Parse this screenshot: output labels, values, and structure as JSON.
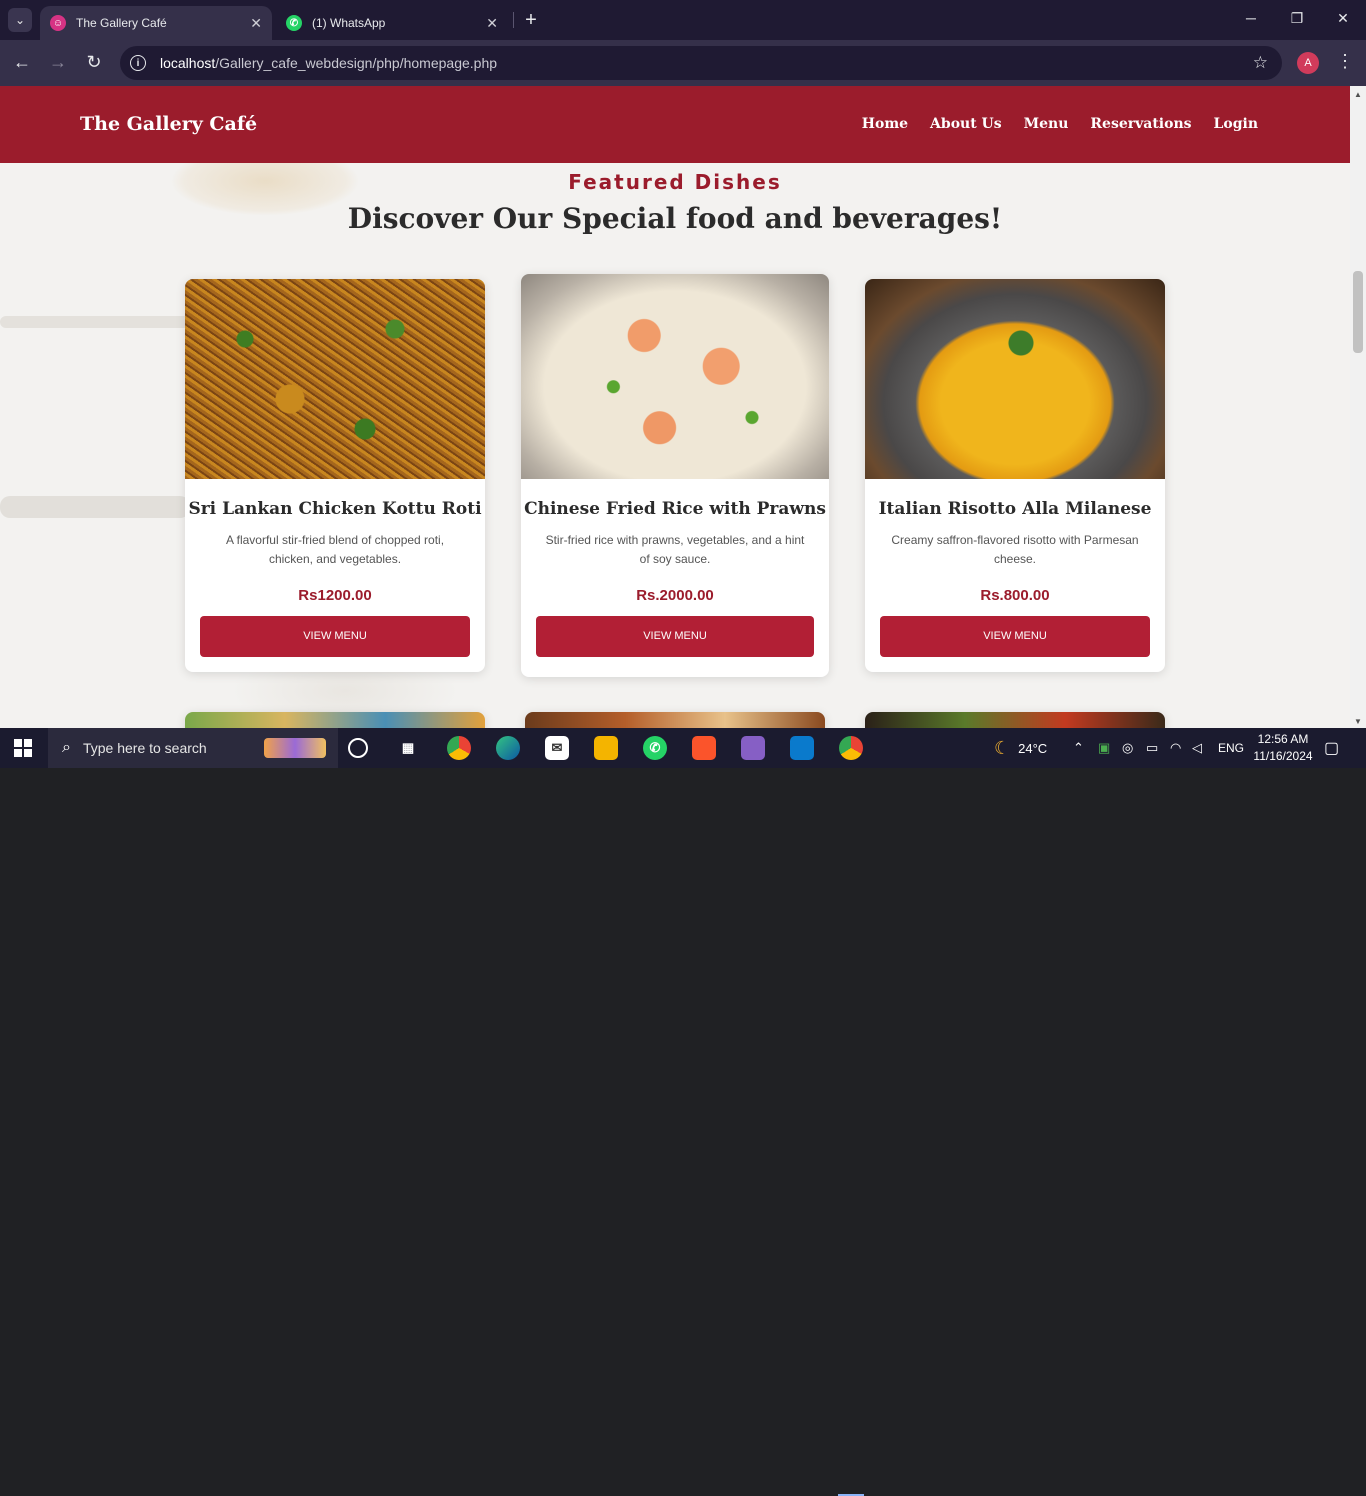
{
  "browser": {
    "tabs": [
      {
        "title": "The Gallery Café",
        "favicon_color": "#d63384",
        "active": true
      },
      {
        "title": "(1) WhatsApp",
        "favicon_color": "#25d366",
        "active": false
      }
    ],
    "url_host": "localhost",
    "url_path": "/Gallery_cafe_webdesign/php/homepage.php",
    "profile_initial": "A"
  },
  "site": {
    "brand": "The Gallery Café",
    "nav": [
      "Home",
      "About Us",
      "Menu",
      "Reservations",
      "Login"
    ],
    "eyebrow": "Featured Dishes",
    "headline": "Discover Our Special food and beverages!",
    "accent_color": "#9b1c2c",
    "button_color": "#b21f35",
    "dishes": [
      {
        "title": "Sri Lankan Chicken Kottu Roti",
        "description": "A flavorful stir-fried blend of chopped roti, chicken, and vegetables.",
        "price": "Rs1200.00",
        "button": "VIEW MENU"
      },
      {
        "title": "Chinese Fried Rice with Prawns",
        "description": "Stir-fried rice with prawns, vegetables, and a hint of soy sauce.",
        "price": "Rs.2000.00",
        "button": "VIEW MENU"
      },
      {
        "title": "Italian Risotto Alla Milanese",
        "description": "Creamy saffron-flavored risotto with Parmesan cheese.",
        "price": "Rs.800.00",
        "button": "VIEW MENU"
      }
    ]
  },
  "taskbar": {
    "search_placeholder": "Type here to search",
    "weather": "24°C",
    "language": "ENG",
    "time": "12:56 AM",
    "date": "11/16/2024"
  }
}
